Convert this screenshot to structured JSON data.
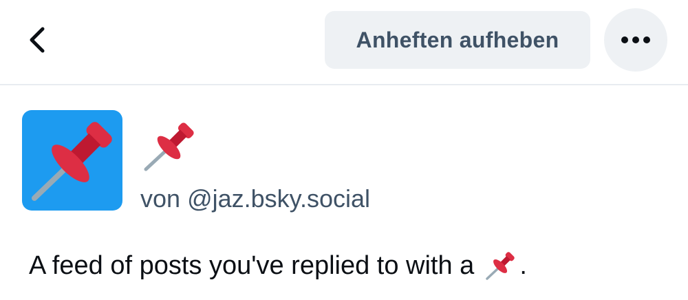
{
  "header": {
    "back_icon": "chevron-left-icon",
    "unpin_label": "Anheften aufheben",
    "more_icon": "ellipsis-icon"
  },
  "feed": {
    "avatar_icon": "pushpin-icon",
    "name_emoji": "📌",
    "creator_prefix": "von",
    "creator_handle": "@jaz.bsky.social",
    "description_text": "A feed of posts you've replied to with a",
    "description_emoji": "📌",
    "description_end": "."
  },
  "colors": {
    "avatar_bg": "#1d9bf0",
    "button_bg": "#eef1f4",
    "button_text": "#3f5266",
    "pin_red": "#dd2e44"
  }
}
